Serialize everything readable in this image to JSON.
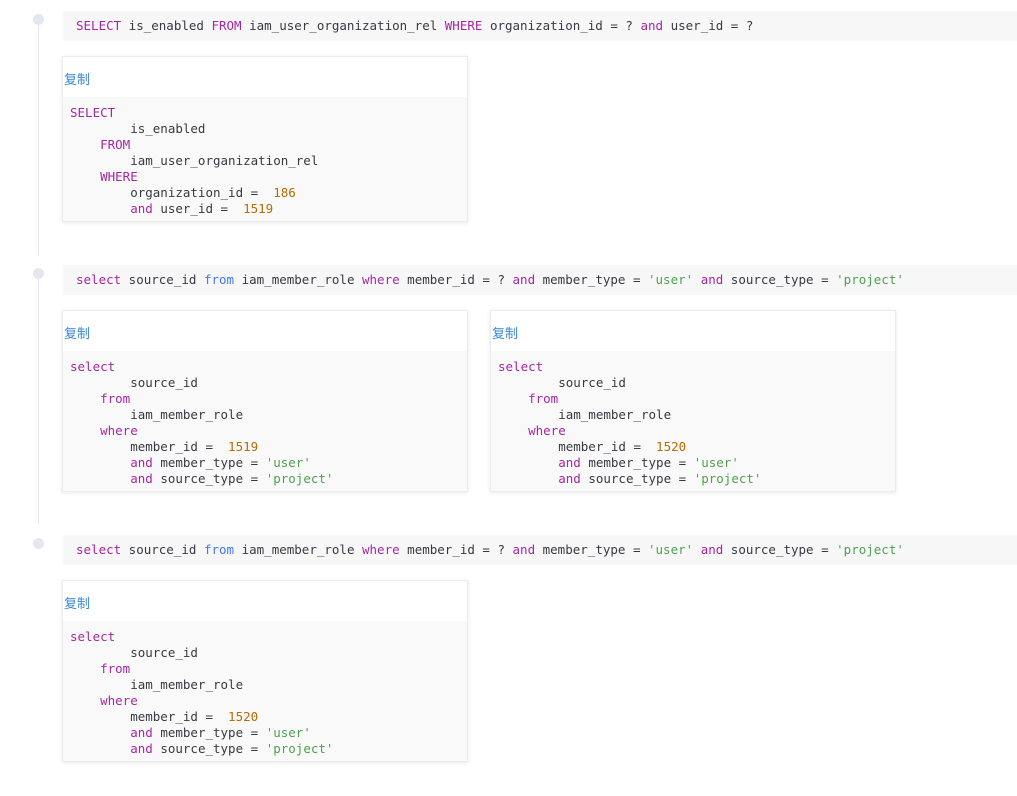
{
  "entries": [
    {
      "sql": [
        {
          "t": "SELECT",
          "c": "kw"
        },
        {
          "t": " is_enabled "
        },
        {
          "t": "FROM",
          "c": "kw"
        },
        {
          "t": " iam_user_organization_rel "
        },
        {
          "t": "WHERE",
          "c": "kw"
        },
        {
          "t": " organization_id = ? "
        },
        {
          "t": "and",
          "c": "kw"
        },
        {
          "t": " user_id = ?"
        }
      ],
      "cards": [
        {
          "copy_label": "复制",
          "lines": [
            [
              {
                "t": "SELECT",
                "c": "kw"
              }
            ],
            [
              {
                "t": "        is_enabled"
              }
            ],
            [
              {
                "t": "    "
              },
              {
                "t": "FROM",
                "c": "kw"
              }
            ],
            [
              {
                "t": "        iam_user_organization_rel"
              }
            ],
            [
              {
                "t": "    "
              },
              {
                "t": "WHERE",
                "c": "kw"
              }
            ],
            [
              {
                "t": "        organization_id =  "
              },
              {
                "t": "186",
                "c": "num"
              }
            ],
            [
              {
                "t": "        "
              },
              {
                "t": "and",
                "c": "kw"
              },
              {
                "t": " user_id =  "
              },
              {
                "t": "1519",
                "c": "num"
              }
            ]
          ]
        }
      ]
    },
    {
      "sql": [
        {
          "t": "select",
          "c": "kw"
        },
        {
          "t": " source_id "
        },
        {
          "t": "from",
          "c": "fn"
        },
        {
          "t": " iam_member_role "
        },
        {
          "t": "where",
          "c": "kw"
        },
        {
          "t": " member_id = ? "
        },
        {
          "t": "and",
          "c": "kw"
        },
        {
          "t": " member_type = "
        },
        {
          "t": "'user'",
          "c": "str"
        },
        {
          "t": " "
        },
        {
          "t": "and",
          "c": "kw"
        },
        {
          "t": " source_type = "
        },
        {
          "t": "'project'",
          "c": "str"
        }
      ],
      "cards": [
        {
          "copy_label": "复制",
          "lines": [
            [
              {
                "t": "select",
                "c": "kw"
              }
            ],
            [
              {
                "t": "        source_id"
              }
            ],
            [
              {
                "t": "    "
              },
              {
                "t": "from",
                "c": "kw"
              }
            ],
            [
              {
                "t": "        iam_member_role"
              }
            ],
            [
              {
                "t": "    "
              },
              {
                "t": "where",
                "c": "kw"
              }
            ],
            [
              {
                "t": "        member_id =  "
              },
              {
                "t": "1519",
                "c": "num"
              }
            ],
            [
              {
                "t": "        "
              },
              {
                "t": "and",
                "c": "kw"
              },
              {
                "t": " member_type = "
              },
              {
                "t": "'user'",
                "c": "str"
              }
            ],
            [
              {
                "t": "        "
              },
              {
                "t": "and",
                "c": "kw"
              },
              {
                "t": " source_type = "
              },
              {
                "t": "'project'",
                "c": "str"
              }
            ]
          ]
        },
        {
          "copy_label": "复制",
          "lines": [
            [
              {
                "t": "select",
                "c": "kw"
              }
            ],
            [
              {
                "t": "        source_id"
              }
            ],
            [
              {
                "t": "    "
              },
              {
                "t": "from",
                "c": "kw"
              }
            ],
            [
              {
                "t": "        iam_member_role"
              }
            ],
            [
              {
                "t": "    "
              },
              {
                "t": "where",
                "c": "kw"
              }
            ],
            [
              {
                "t": "        member_id =  "
              },
              {
                "t": "1520",
                "c": "num"
              }
            ],
            [
              {
                "t": "        "
              },
              {
                "t": "and",
                "c": "kw"
              },
              {
                "t": " member_type = "
              },
              {
                "t": "'user'",
                "c": "str"
              }
            ],
            [
              {
                "t": "        "
              },
              {
                "t": "and",
                "c": "kw"
              },
              {
                "t": " source_type = "
              },
              {
                "t": "'project'",
                "c": "str"
              }
            ]
          ]
        }
      ]
    },
    {
      "sql": [
        {
          "t": "select",
          "c": "kw"
        },
        {
          "t": " source_id "
        },
        {
          "t": "from",
          "c": "fn"
        },
        {
          "t": " iam_member_role "
        },
        {
          "t": "where",
          "c": "kw"
        },
        {
          "t": " member_id = ? "
        },
        {
          "t": "and",
          "c": "kw"
        },
        {
          "t": " member_type = "
        },
        {
          "t": "'user'",
          "c": "str"
        },
        {
          "t": " "
        },
        {
          "t": "and",
          "c": "kw"
        },
        {
          "t": " source_type = "
        },
        {
          "t": "'project'",
          "c": "str"
        }
      ],
      "cards": [
        {
          "copy_label": "复制",
          "lines": [
            [
              {
                "t": "select",
                "c": "kw"
              }
            ],
            [
              {
                "t": "        source_id"
              }
            ],
            [
              {
                "t": "    "
              },
              {
                "t": "from",
                "c": "kw"
              }
            ],
            [
              {
                "t": "        iam_member_role"
              }
            ],
            [
              {
                "t": "    "
              },
              {
                "t": "where",
                "c": "kw"
              }
            ],
            [
              {
                "t": "        member_id =  "
              },
              {
                "t": "1520",
                "c": "num"
              }
            ],
            [
              {
                "t": "        "
              },
              {
                "t": "and",
                "c": "kw"
              },
              {
                "t": " member_type = "
              },
              {
                "t": "'user'",
                "c": "str"
              }
            ],
            [
              {
                "t": "        "
              },
              {
                "t": "and",
                "c": "kw"
              },
              {
                "t": " source_type = "
              },
              {
                "t": "'project'",
                "c": "str"
              }
            ]
          ]
        }
      ]
    }
  ]
}
